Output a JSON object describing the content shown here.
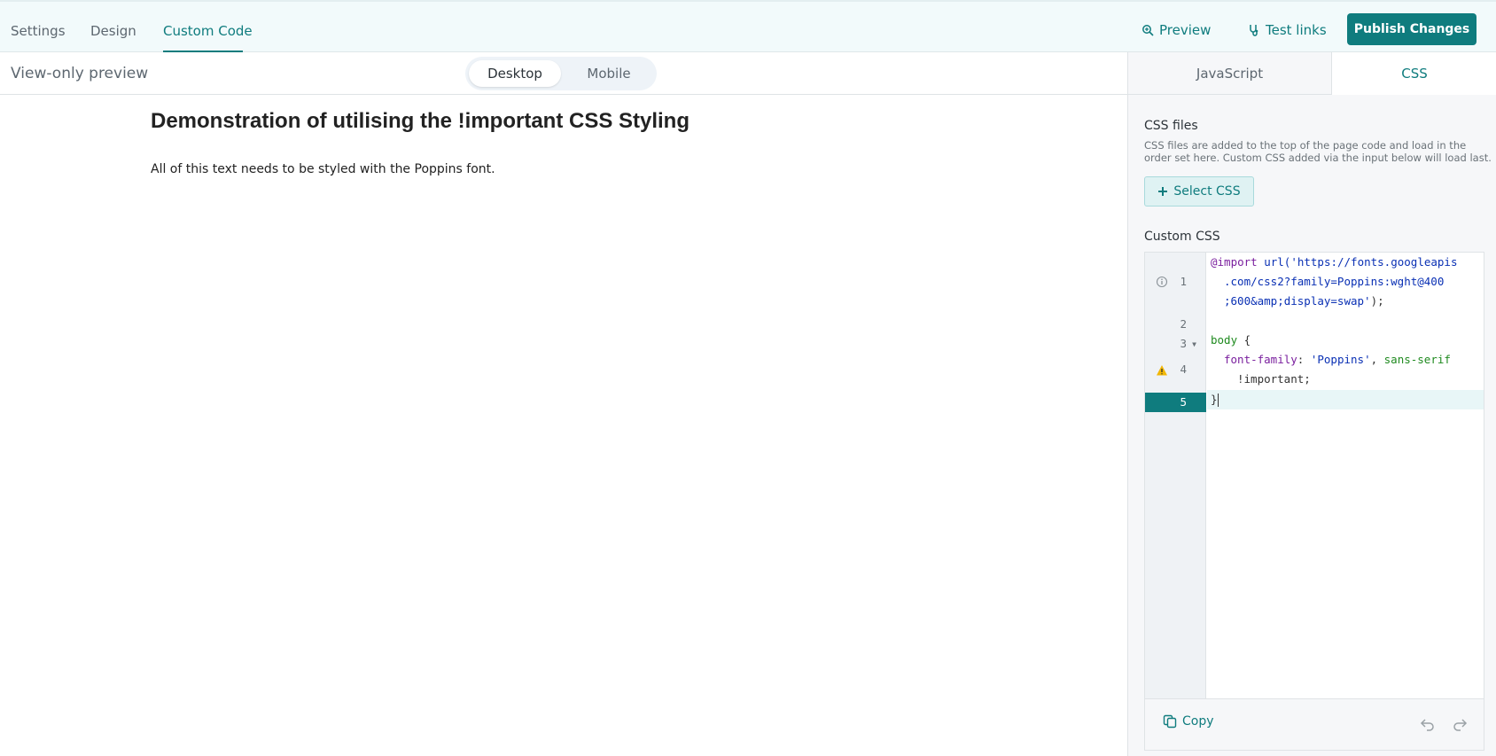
{
  "topbar": {
    "tabs": [
      {
        "label": "Settings"
      },
      {
        "label": "Design"
      },
      {
        "label": "Custom Code"
      }
    ],
    "preview_label": "Preview",
    "test_links_label": "Test links",
    "publish_label": "Publish Changes"
  },
  "preview": {
    "view_only_label": "View-only preview",
    "toggle": {
      "desktop": "Desktop",
      "mobile": "Mobile",
      "selected": "Desktop"
    },
    "heading": "Demonstration of utilising the !important CSS Styling",
    "body_text": "All of this text needs to be styled with the Poppins font."
  },
  "code_panel": {
    "tabs": [
      {
        "label": "JavaScript"
      },
      {
        "label": "CSS"
      }
    ],
    "active_tab": "CSS",
    "css_files_heading": "CSS files",
    "css_files_description": "CSS files are added to the top of the page code and load in the order set here. Custom CSS added via the input below will load last.",
    "select_css_label": "Select CSS",
    "custom_css_heading": "Custom CSS",
    "line_numbers": [
      "1",
      "2",
      "3",
      "4",
      "5"
    ],
    "code_lines": {
      "l1a_kw": "@import",
      "l1a_fn": " url(",
      "l1a_str": "'https://fonts.googleapis",
      "l1b_str": ".com/css2?family=Poppins:wght@400",
      "l1c_str": ";600&amp;display=swap'",
      "l1c_punc": ");",
      "l3_sel": "body",
      "l3_punc": " {",
      "l4_prop": "font-family",
      "l4_punc1": ": ",
      "l4_str": "'Poppins'",
      "l4_punc2": ", ",
      "l4_val": "sans-serif",
      "l4b": "!important;",
      "l5": "}"
    },
    "copy_label": "Copy"
  },
  "colors": {
    "accent": "#0f7c7e",
    "warning": "#f2b705"
  }
}
